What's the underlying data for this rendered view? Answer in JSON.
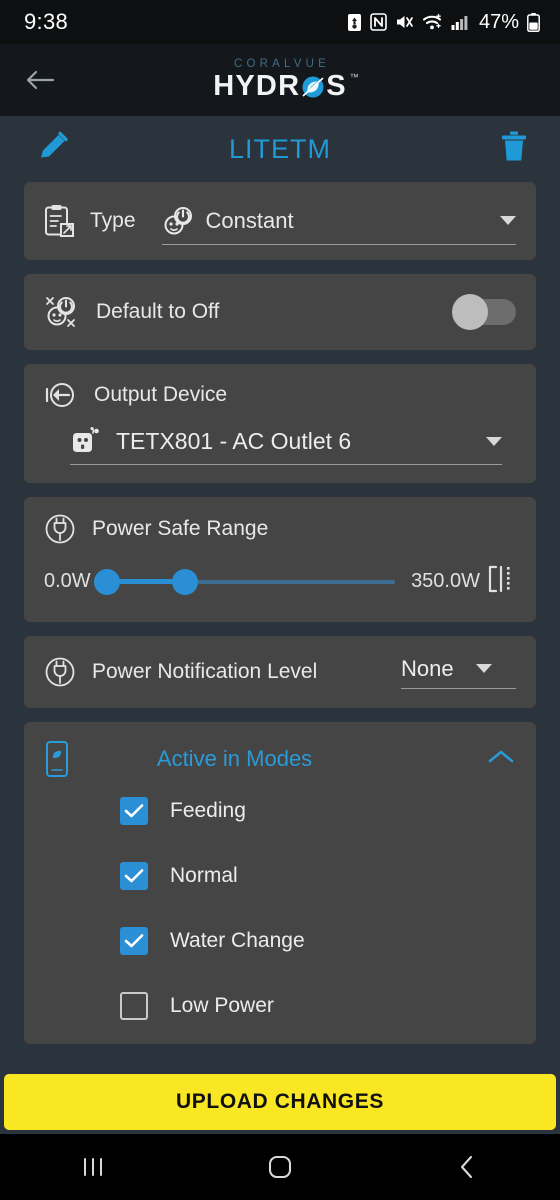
{
  "statusbar": {
    "clock": "9:38",
    "battery_percent": "47%",
    "icons": [
      "battery-saver-icon",
      "nfc-icon",
      "mute-vibrate-icon",
      "wifi-icon",
      "cellular-signal-icon",
      "battery-icon"
    ]
  },
  "appbar": {
    "back_icon": "back-arrow-icon",
    "brand_top": "CORALVUE",
    "brand_main": "HYDR S",
    "brand_main_pre": "HYDR",
    "brand_main_post": "S",
    "trademark": "™"
  },
  "title_row": {
    "edit_icon": "pencil-icon",
    "title": "LITETM",
    "delete_icon": "trash-icon",
    "title_color": "#1f9ad6"
  },
  "type_card": {
    "icon": "clipboard-edit-icon",
    "label": "Type",
    "value_icon": "outlet-power-icon",
    "value": "Constant",
    "caret": "chevron-down-icon"
  },
  "default_off_card": {
    "icon": "outlet-off-icon",
    "label": "Default to Off",
    "toggle_state": "off"
  },
  "output_device_card": {
    "icon": "output-arrow-icon",
    "label": "Output Device",
    "value_icon": "outlet-icon",
    "value": "TETX801 - AC Outlet 6",
    "caret": "chevron-down-icon"
  },
  "power_safe_range_card": {
    "icon": "power-plug-circle-icon",
    "label": "Power Safe Range",
    "min_label": "0.0W",
    "max_label": "350.0W",
    "min_value": 0,
    "max_value": 350,
    "thumb1_percent": 0,
    "thumb2_percent": 27,
    "range_icon": "range-bracket-icon",
    "accent": "#2a8fd4"
  },
  "power_notification_card": {
    "icon": "power-plug-circle-icon",
    "label": "Power Notification Level",
    "value": "None",
    "caret": "chevron-down-icon"
  },
  "active_modes_card": {
    "icon": "device-screen-icon",
    "title": "Active in Modes",
    "collapse_icon": "chevron-up-icon",
    "modes": [
      {
        "label": "Feeding",
        "checked": true
      },
      {
        "label": "Normal",
        "checked": true
      },
      {
        "label": "Water Change",
        "checked": true
      },
      {
        "label": "Low Power",
        "checked": false
      }
    ]
  },
  "upload_button": {
    "label": "UPLOAD CHANGES",
    "color": "#fae723"
  },
  "navbar": {
    "recents_icon": "recents-icon",
    "home_icon": "home-icon",
    "back_icon": "back-chevron-icon"
  }
}
